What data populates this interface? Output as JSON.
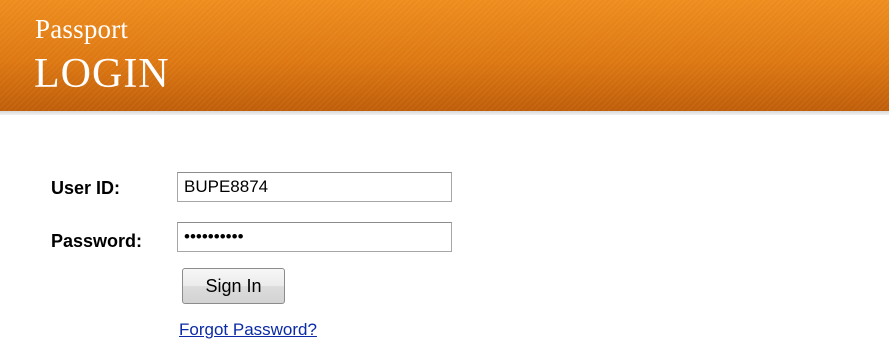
{
  "header": {
    "subtitle": "Passport",
    "title": "LOGIN",
    "colors": {
      "banner": "#e07c12",
      "text": "#ffffff"
    }
  },
  "form": {
    "user_id_label": "User ID:",
    "user_id_value": "BUPE8874",
    "password_label": "Password:",
    "password_value": "••••••••••",
    "signin_label": "Sign In",
    "forgot_link": "Forgot Password?",
    "colors": {
      "link": "#0b2aa6"
    }
  }
}
